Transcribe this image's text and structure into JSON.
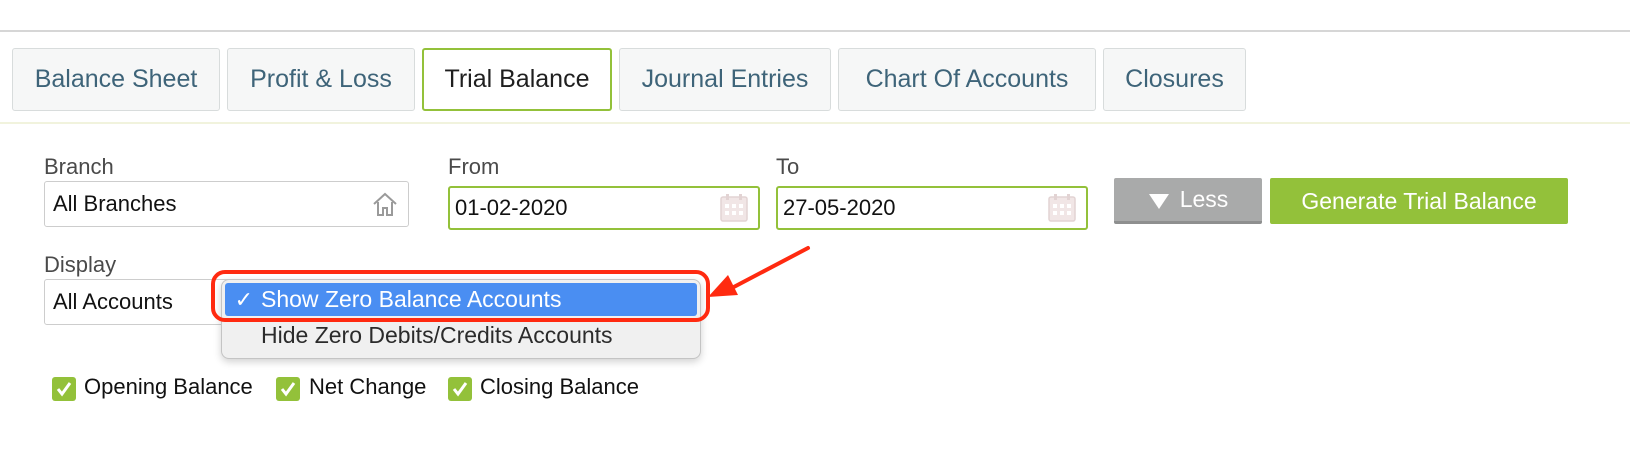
{
  "tabs": [
    {
      "label": "Balance Sheet",
      "active": false
    },
    {
      "label": "Profit & Loss",
      "active": false
    },
    {
      "label": "Trial Balance",
      "active": true
    },
    {
      "label": "Journal Entries",
      "active": false
    },
    {
      "label": "Chart Of Accounts",
      "active": false
    },
    {
      "label": "Closures",
      "active": false
    }
  ],
  "filters": {
    "branch_label": "Branch",
    "branch_value": "All Branches",
    "from_label": "From",
    "from_value": "01-02-2020",
    "to_label": "To",
    "to_value": "27-05-2020",
    "display_label": "Display",
    "display_value": "All Accounts"
  },
  "buttons": {
    "less": "Less",
    "generate": "Generate Trial Balance"
  },
  "dropdown": {
    "options": [
      {
        "label": "Show Zero Balance Accounts",
        "checked": true,
        "check_glyph": "✓"
      },
      {
        "label": "Hide Zero Debits/Credits Accounts",
        "checked": false
      }
    ]
  },
  "checkboxes": [
    {
      "label": "Opening Balance",
      "checked": true
    },
    {
      "label": "Net Change",
      "checked": true
    },
    {
      "label": "Closing Balance",
      "checked": true
    }
  ],
  "colors": {
    "accent_green": "#93c13a",
    "menu_selected": "#4a8ef2",
    "annotation_red": "#ff2a10",
    "tab_text": "#3e6479"
  },
  "icons": {
    "branch_field": "home-icon",
    "date_fields": "calendar-icon",
    "less_button": "triangle-down-icon"
  }
}
